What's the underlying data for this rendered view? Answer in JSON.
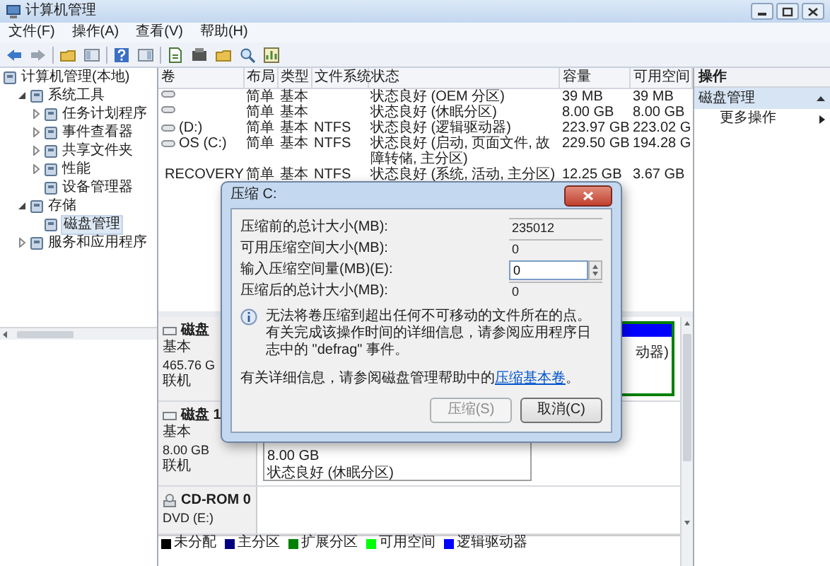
{
  "window": {
    "title": "计算机管理"
  },
  "menu": [
    "文件(F)",
    "操作(A)",
    "查看(V)",
    "帮助(H)"
  ],
  "tree": [
    {
      "kind": "root",
      "label": "计算机管理(本地)",
      "selected": false,
      "children": [
        {
          "kind": "branch",
          "label": "系统工具",
          "expanded": true,
          "selected": false,
          "children": [
            {
              "kind": "branch",
              "label": "任务计划程序",
              "expanded": false,
              "selected": false
            },
            {
              "kind": "branch",
              "label": "事件查看器",
              "expanded": false,
              "selected": false
            },
            {
              "kind": "branch",
              "label": "共享文件夹",
              "expanded": false,
              "selected": false
            },
            {
              "kind": "branch",
              "label": "性能",
              "expanded": false,
              "selected": false
            },
            {
              "kind": "leaf",
              "label": "设备管理器",
              "selected": false
            }
          ]
        },
        {
          "kind": "branch",
          "label": "存储",
          "expanded": true,
          "selected": false,
          "children": [
            {
              "kind": "leaf",
              "label": "磁盘管理",
              "selected": true
            }
          ]
        },
        {
          "kind": "branch",
          "label": "服务和应用程序",
          "expanded": false,
          "selected": false
        }
      ]
    }
  ],
  "volumes": {
    "columns": [
      "卷",
      "布局",
      "类型",
      "文件系统",
      "状态",
      "容量",
      "可用空间"
    ],
    "rows": [
      [
        "",
        "简单",
        "基本",
        "",
        "状态良好 (OEM 分区)",
        "39 MB",
        "39 MB"
      ],
      [
        "",
        "简单",
        "基本",
        "",
        "状态良好 (休眠分区)",
        "8.00 GB",
        "8.00 GB"
      ],
      [
        "(D:)",
        "简单",
        "基本",
        "NTFS",
        "状态良好 (逻辑驱动器)",
        "223.97 GB",
        "223.02 G"
      ],
      [
        "OS (C:)",
        "简单",
        "基本",
        "NTFS",
        "状态良好 (启动, 页面文件, 故障转储, 主分区)",
        "229.50 GB",
        "194.28 G"
      ],
      [
        "RECOVERY",
        "简单",
        "基本",
        "NTFS",
        "状态良好 (系统, 活动, 主分区)",
        "12.25 GB",
        "3.67 GB"
      ]
    ]
  },
  "disks": [
    {
      "kind": "disk",
      "name": "磁盘",
      "lines": [
        "基本",
        "465.76 G",
        "联机"
      ],
      "partitions": [
        {
          "kind": "logical",
          "lines": [
            "动器)"
          ]
        }
      ]
    },
    {
      "kind": "disk",
      "name": "磁盘 1",
      "lines": [
        "基本",
        "8.00 GB",
        "联机"
      ],
      "partitions": [
        {
          "kind": "primary",
          "lines": [
            "8.00 GB",
            "状态良好 (休眠分区)"
          ]
        }
      ]
    },
    {
      "kind": "cdrom",
      "name": "CD-ROM 0",
      "lines": [
        "DVD (E:)"
      ]
    }
  ],
  "legend": [
    {
      "label": "未分配",
      "color": "#000000"
    },
    {
      "label": "主分区",
      "color": "#000080"
    },
    {
      "label": "扩展分区",
      "color": "#008000"
    },
    {
      "label": "可用空间",
      "color": "#00ff00"
    },
    {
      "label": "逻辑驱动器",
      "color": "#0000ff"
    }
  ],
  "actions": {
    "title": "操作",
    "section": "磁盘管理",
    "items": [
      "更多操作"
    ]
  },
  "dialog": {
    "title": "压缩 C:",
    "fields": [
      {
        "kind": "readonly",
        "label": "压缩前的总计大小(MB):",
        "value": "235012"
      },
      {
        "kind": "readonly",
        "label": "可用压缩空间大小(MB):",
        "value": "0"
      },
      {
        "kind": "spin",
        "label": "输入压缩空间量(MB)(E):",
        "value": "0"
      },
      {
        "kind": "readonly",
        "label": "压缩后的总计大小(MB):",
        "value": "0"
      }
    ],
    "info": "无法将卷压缩到超出任何不可移动的文件所在的点。有关完成该操作时间的详细信息，请参阅应用程序日志中的 \"defrag\" 事件。",
    "help": "有关详细信息，请参阅磁盘管理帮助中的",
    "help_link": "压缩基本卷",
    "help_end": "。",
    "buttons": [
      {
        "label": "压缩(S)",
        "disabled": true
      },
      {
        "label": "取消(C)",
        "disabled": false
      }
    ]
  }
}
